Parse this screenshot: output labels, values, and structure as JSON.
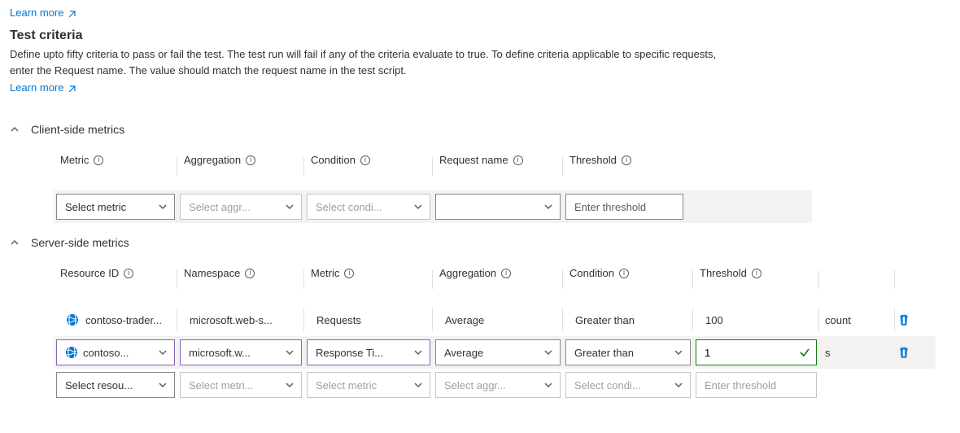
{
  "top_link": "Learn more",
  "heading": "Test criteria",
  "description": "Define upto fifty criteria to pass or fail the test. The test run will fail if any of the criteria evaluate to true. To define criteria applicable to specific requests, enter the Request name. The value should match the request name in the test script.",
  "learn_more": "Learn more",
  "sections": {
    "client": {
      "title": "Client-side metrics"
    },
    "server": {
      "title": "Server-side metrics"
    }
  },
  "client_headers": {
    "metric": "Metric",
    "aggregation": "Aggregation",
    "condition": "Condition",
    "request_name": "Request name",
    "threshold": "Threshold"
  },
  "client_row": {
    "metric_placeholder": "Select metric",
    "aggregation_placeholder": "Select aggr...",
    "condition_placeholder": "Select condi...",
    "request_value": "",
    "threshold_placeholder": "Enter threshold"
  },
  "server_headers": {
    "resource": "Resource ID",
    "namespace": "Namespace",
    "metric": "Metric",
    "aggregation": "Aggregation",
    "condition": "Condition",
    "threshold": "Threshold"
  },
  "server_rows": [
    {
      "resource": "contoso-trader...",
      "namespace": "microsoft.web-s...",
      "metric": "Requests",
      "aggregation": "Average",
      "condition": "Greater than",
      "threshold": "100",
      "unit": "count"
    },
    {
      "resource": "contoso...",
      "namespace": "microsoft.w...",
      "metric": "Response Ti...",
      "aggregation": "Average",
      "condition": "Greater than",
      "threshold": "1",
      "unit": "s"
    },
    {
      "resource_placeholder": "Select resou...",
      "namespace_placeholder": "Select metri...",
      "metric_placeholder": "Select metric",
      "aggregation_placeholder": "Select aggr...",
      "condition_placeholder": "Select condi...",
      "threshold_placeholder": "Enter threshold"
    }
  ]
}
